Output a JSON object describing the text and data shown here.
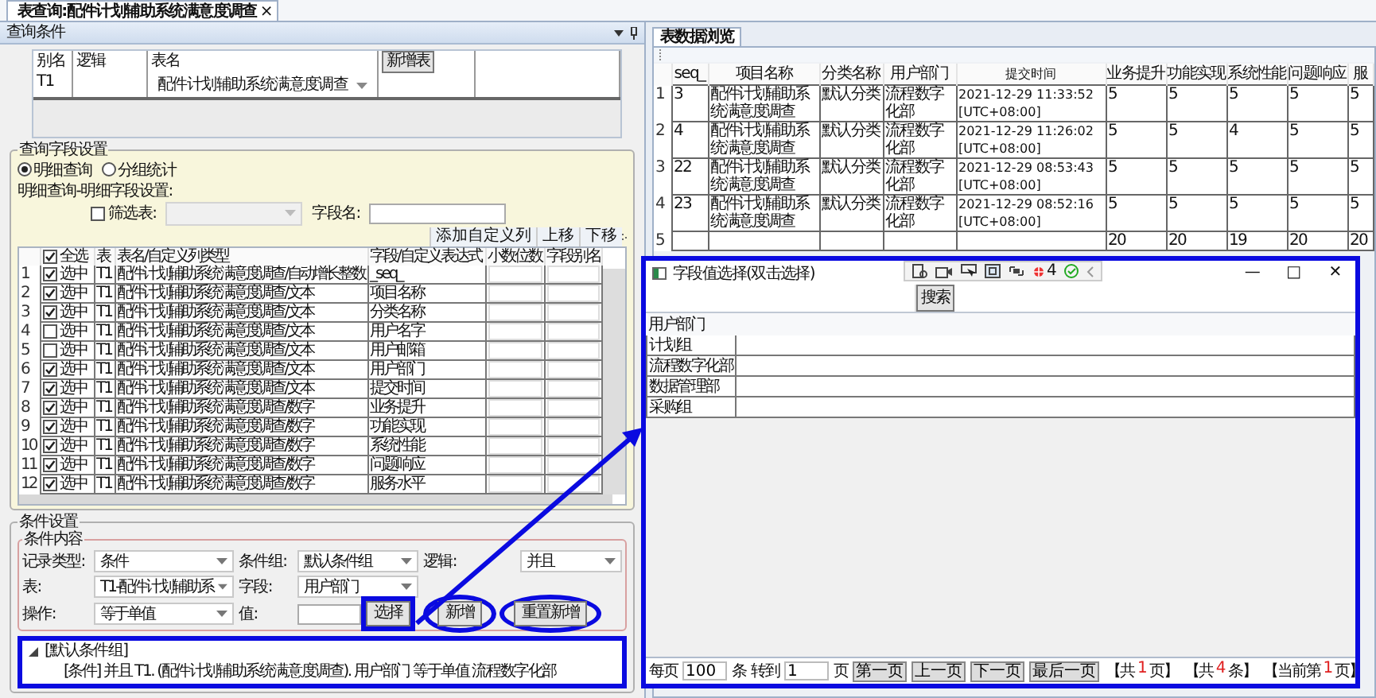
{
  "document_tab": {
    "label": "表查询:配件计划辅助系统满意度调查",
    "close": "×"
  },
  "query_panel": {
    "title": "查询条件",
    "table_grid": {
      "columns": [
        "别名",
        "逻辑",
        "表名"
      ],
      "add_button": "新增表",
      "rows": [
        {
          "alias": "T1",
          "table": "配件计划辅助系统满意度调查"
        }
      ]
    },
    "field_settings": {
      "title": "查询字段设置",
      "modes": [
        {
          "label": "明细查询",
          "selected": true
        },
        {
          "label": "分组统计",
          "selected": false
        }
      ],
      "subtitle": "明细查询-明细字段设置:",
      "filter": {
        "label": "筛选表:",
        "checked": false
      },
      "field_name_label": "字段名:",
      "toolbar": [
        "添加自定义列",
        "上移",
        "下移"
      ],
      "select_all": {
        "label": "全选",
        "checked": true
      },
      "columns": [
        "表",
        "表名/自定义列类型",
        "字段/自定义表达式",
        "小数位数",
        "字段别名"
      ],
      "rows": [
        {
          "index": "1",
          "checked": true,
          "select_label": "选中",
          "table": "T1",
          "type": "配件计划辅助系统满意度调查/自动增长整数",
          "field": "_seq_"
        },
        {
          "index": "2",
          "checked": true,
          "select_label": "选中",
          "table": "T1",
          "type": "配件计划辅助系统满意度调查/文本",
          "field": "项目名称"
        },
        {
          "index": "3",
          "checked": true,
          "select_label": "选中",
          "table": "T1",
          "type": "配件计划辅助系统满意度调查/文本",
          "field": "分类名称"
        },
        {
          "index": "4",
          "checked": false,
          "select_label": "选中",
          "table": "T1",
          "type": "配件计划辅助系统满意度调查/文本",
          "field": "用户名字"
        },
        {
          "index": "5",
          "checked": false,
          "select_label": "选中",
          "table": "T1",
          "type": "配件计划辅助系统满意度调查/文本",
          "field": "用户邮箱"
        },
        {
          "index": "6",
          "checked": true,
          "select_label": "选中",
          "table": "T1",
          "type": "配件计划辅助系统满意度调查/文本",
          "field": "用户部门"
        },
        {
          "index": "7",
          "checked": true,
          "select_label": "选中",
          "table": "T1",
          "type": "配件计划辅助系统满意度调查/文本",
          "field": "提交时间"
        },
        {
          "index": "8",
          "checked": true,
          "select_label": "选中",
          "table": "T1",
          "type": "配件计划辅助系统满意度调查/数字",
          "field": "业务提升"
        },
        {
          "index": "9",
          "checked": true,
          "select_label": "选中",
          "table": "T1",
          "type": "配件计划辅助系统满意度调查/数字",
          "field": "功能实现"
        },
        {
          "index": "10",
          "checked": true,
          "select_label": "选中",
          "table": "T1",
          "type": "配件计划辅助系统满意度调查/数字",
          "field": "系统性能"
        },
        {
          "index": "11",
          "checked": true,
          "select_label": "选中",
          "table": "T1",
          "type": "配件计划辅助系统满意度调查/数字",
          "field": "问题响应"
        },
        {
          "index": "12",
          "checked": true,
          "select_label": "选中",
          "table": "T1",
          "type": "配件计划辅助系统满意度调查/数字",
          "field": "服务水平"
        }
      ]
    },
    "conditions": {
      "title": "条件设置",
      "subtitle": "条件内容",
      "fields": [
        {
          "label": "记录类型:",
          "kind": "dropdown",
          "value": "条件"
        },
        {
          "label": "条件组:",
          "kind": "dropdown",
          "value": "默认条件组"
        },
        {
          "label": "逻辑:",
          "kind": "dropdown",
          "value": "并且"
        },
        {
          "label": "表:",
          "kind": "dropdown",
          "value": "T1-配件计划辅助系"
        },
        {
          "label": "字段:",
          "kind": "dropdown",
          "value": "用户部门"
        },
        {
          "label": "操作:",
          "kind": "dropdown",
          "value": "等于单值"
        },
        {
          "label": "值:",
          "kind": "input"
        }
      ],
      "buttons": [
        {
          "label": "选择",
          "boxed": true,
          "circled": false
        },
        {
          "label": "新增",
          "boxed": false,
          "circled": true
        },
        {
          "label": "重置新增",
          "boxed": false,
          "circled": true
        }
      ],
      "tree": {
        "highlighted": true,
        "group": "[默认条件组]",
        "expanded": true,
        "children": [
          {
            "text": "[条件] 并且 T1. (配件计划辅助系统满意度调查). 用户部门 等于单值 流程数字化部"
          }
        ]
      }
    }
  },
  "data_view": {
    "tab": "表数据浏览",
    "columns": [
      "seq_",
      "项目名称",
      "分类名称",
      "用户部门",
      "提交时间",
      "业务提升",
      "功能实现",
      "系统性能",
      "问题响应",
      "服"
    ],
    "rows": [
      {
        "index": "1",
        "cells": [
          "3",
          "配件计划辅助系统满意度调查",
          "默认分类",
          "流程数字化部",
          "2021-12-29 11:33:52 [UTC+08:00]",
          "5",
          "5",
          "5",
          "5",
          "5"
        ]
      },
      {
        "index": "2",
        "cells": [
          "4",
          "配件计划辅助系统满意度调查",
          "默认分类",
          "流程数字化部",
          "2021-12-29 11:26:02 [UTC+08:00]",
          "5",
          "5",
          "4",
          "5",
          "5"
        ]
      },
      {
        "index": "3",
        "cells": [
          "22",
          "配件计划辅助系统满意度调查",
          "默认分类",
          "流程数字化部",
          "2021-12-29 08:53:43 [UTC+08:00]",
          "5",
          "5",
          "5",
          "5",
          "5"
        ]
      },
      {
        "index": "4",
        "cells": [
          "23",
          "配件计划辅助系统满意度调查",
          "默认分类",
          "流程数字化部",
          "2021-12-29 08:52:16 [UTC+08:00]",
          "5",
          "5",
          "5",
          "5",
          "5"
        ]
      }
    ],
    "totals": {
      "index": "5",
      "cells": [
        "20",
        "20",
        "19",
        "20",
        "20"
      ]
    }
  },
  "dialog": {
    "highlighted": true,
    "title": "字段值选择(双击选择)",
    "window_buttons": [
      "—",
      "□",
      "✕"
    ],
    "capture_toolbar": {
      "count": "4"
    },
    "search_button": "搜索",
    "column": "用户部门",
    "rows": [
      "计划组",
      "流程数字化部",
      "数据管理部",
      "采购组"
    ],
    "pager": {
      "per_page_label": "每页",
      "per_page": "100",
      "per_page_unit": "条",
      "goto_label": "转到",
      "goto": "1",
      "goto_unit": "页",
      "buttons": [
        "第一页",
        "上一页",
        "下一页",
        "最后一页"
      ],
      "summaries": [
        {
          "before": "【共",
          "count": "1",
          "after": "页】"
        },
        {
          "before": "【共",
          "count": "4",
          "after": "条】"
        },
        {
          "before": "【当前第",
          "count": "1",
          "after": "页】"
        }
      ]
    }
  },
  "annotation_arrow": true
}
